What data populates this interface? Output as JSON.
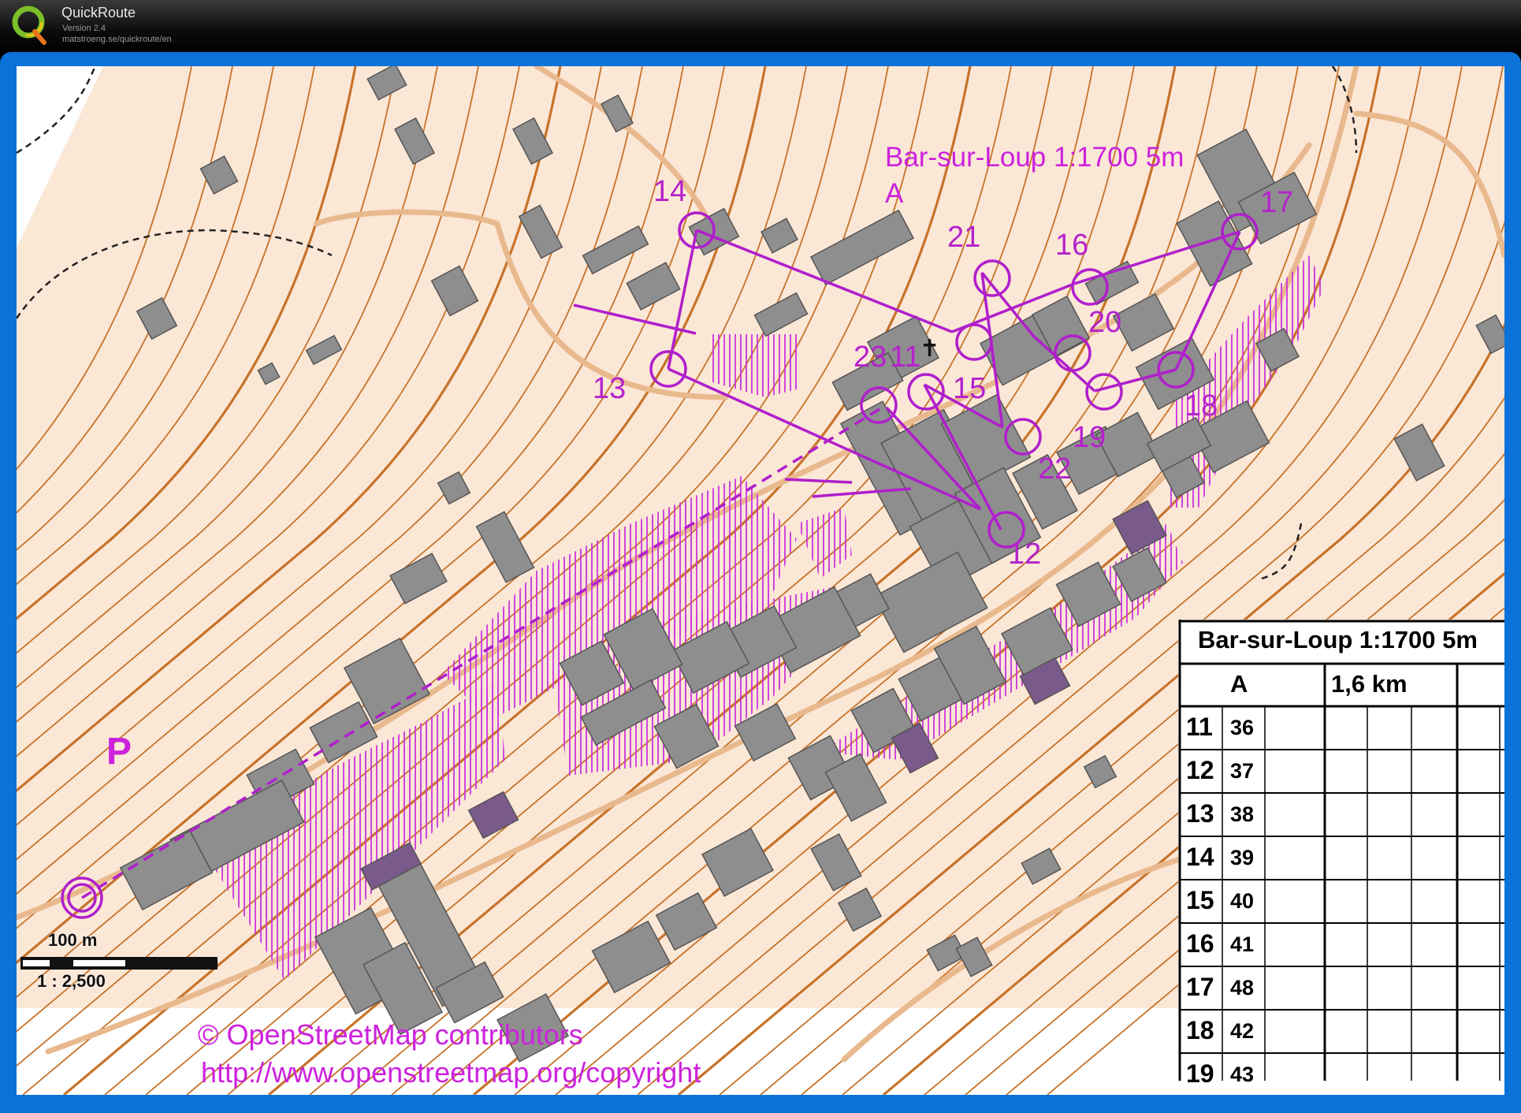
{
  "app": {
    "name": "QuickRoute",
    "version": "Version 2.4",
    "url": "matstroeng.se/quickroute/en"
  },
  "map": {
    "title": "Bar-sur-Loup 1:1700 5m",
    "course": "A",
    "start_label": "P",
    "controls": [
      "14",
      "13",
      "21",
      "16",
      "20",
      "17",
      "23",
      "11",
      "15",
      "19",
      "22",
      "18",
      "12"
    ],
    "scale_distance": "100 m",
    "scale_ratio": "1 : 2,500",
    "copyright_line1": "© OpenStreetMap contributors",
    "copyright_line2": "http://www.openstreetmap.org/copyright",
    "colors": {
      "background": "#fbe7d6",
      "contour": "#c7732a",
      "building": "#8e8e8e",
      "course": "#b01fcc",
      "hatch": "#cc33dd",
      "frame": "#0a72d8"
    }
  },
  "descriptions": {
    "title": "Bar-sur-Loup 1:1700 5m",
    "course": "A",
    "length": "1,6 km",
    "rows": [
      {
        "num": "11",
        "code": "36"
      },
      {
        "num": "12",
        "code": "37"
      },
      {
        "num": "13",
        "code": "38"
      },
      {
        "num": "14",
        "code": "39"
      },
      {
        "num": "15",
        "code": "40"
      },
      {
        "num": "16",
        "code": "41"
      },
      {
        "num": "17",
        "code": "48"
      },
      {
        "num": "18",
        "code": "42"
      },
      {
        "num": "19",
        "code": "43"
      }
    ]
  }
}
